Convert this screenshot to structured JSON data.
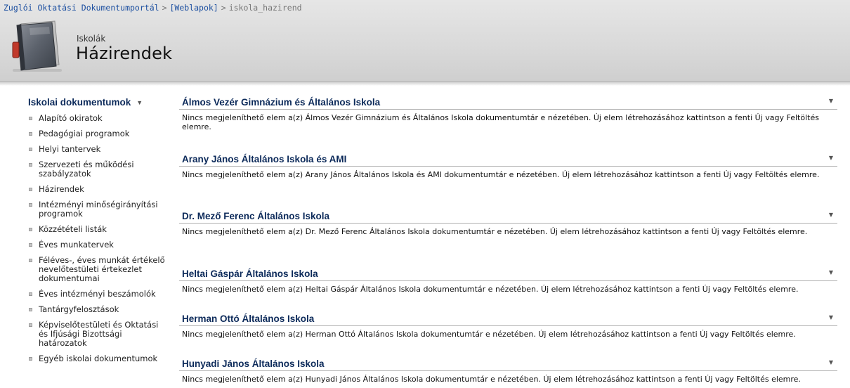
{
  "breadcrumb": {
    "home": "Zuglói Oktatási Dokumentumportál",
    "sep1": ">",
    "section": "[Weblapok]",
    "sep2": ">",
    "current": "iskola_hazirend"
  },
  "header": {
    "subtitle": "Iskolák",
    "title": "Házirendek",
    "logo_icon": "book-icon"
  },
  "leftnav": {
    "heading": "Iskolai dokumentumok",
    "heading_arrow": "▼",
    "items": [
      "Alapító okiratok",
      "Pedagógiai programok",
      "Helyi tantervek",
      "Szervezeti és működési szabályzatok",
      "Házirendek",
      "Intézményi minőségirányítási programok",
      "Közzétételi listák",
      "Éves munkatervek",
      "Féléves-, éves munkát értékelő nevelőtestületi értekezlet dokumentumai",
      "Éves intézményi beszámolók",
      "Tantárgyfelosztások",
      "Képviselőtestületi és Oktatási és Ifjúsági Bizottsági határozatok",
      "Egyéb iskolai dokumentumok"
    ]
  },
  "sections": [
    {
      "title": "Álmos Vezér Gimnázium és Általános Iskola",
      "body": "Nincs megjeleníthető elem a(z) Álmos Vezér Gimnázium és Általános Iskola dokumentumtár e nézetében. Új elem létrehozásához kattintson a fenti Új vagy Feltöltés elemre."
    },
    {
      "title": "Arany János Általános Iskola és AMI",
      "body": "Nincs megjeleníthető elem a(z) Arany János Általános Iskola és AMI dokumentumtár e nézetében. Új elem létrehozásához kattintson a fenti Új vagy Feltöltés elemre."
    },
    {
      "title": "Dr. Mező Ferenc Általános Iskola",
      "body": "Nincs megjeleníthető elem a(z) Dr. Mező Ferenc Általános Iskola dokumentumtár e nézetében. Új elem létrehozásához kattintson a fenti Új vagy Feltöltés elemre."
    },
    {
      "title": "Heltai Gáspár Általános Iskola",
      "body": "Nincs megjeleníthető elem a(z) Heltai Gáspár Általános Iskola dokumentumtár e nézetében. Új elem létrehozásához kattintson a fenti Új vagy Feltöltés elemre."
    },
    {
      "title": "Herman Ottó Általános Iskola",
      "body": "Nincs megjeleníthető elem a(z) Herman Ottó Általános Iskola dokumentumtár e nézetében. Új elem létrehozásához kattintson a fenti Új vagy Feltöltés elemre."
    },
    {
      "title": "Hunyadi János Általános Iskola",
      "body": "Nincs megjeleníthető elem a(z) Hunyadi János Általános Iskola dokumentumtár e nézetében. Új elem létrehozásához kattintson a fenti Új vagy Feltöltés elemre."
    }
  ],
  "section_arrow": "▼",
  "colors": {
    "heading": "#0c2a5a",
    "link": "#1c4fa0",
    "header_bg": "#d9d9d9"
  }
}
